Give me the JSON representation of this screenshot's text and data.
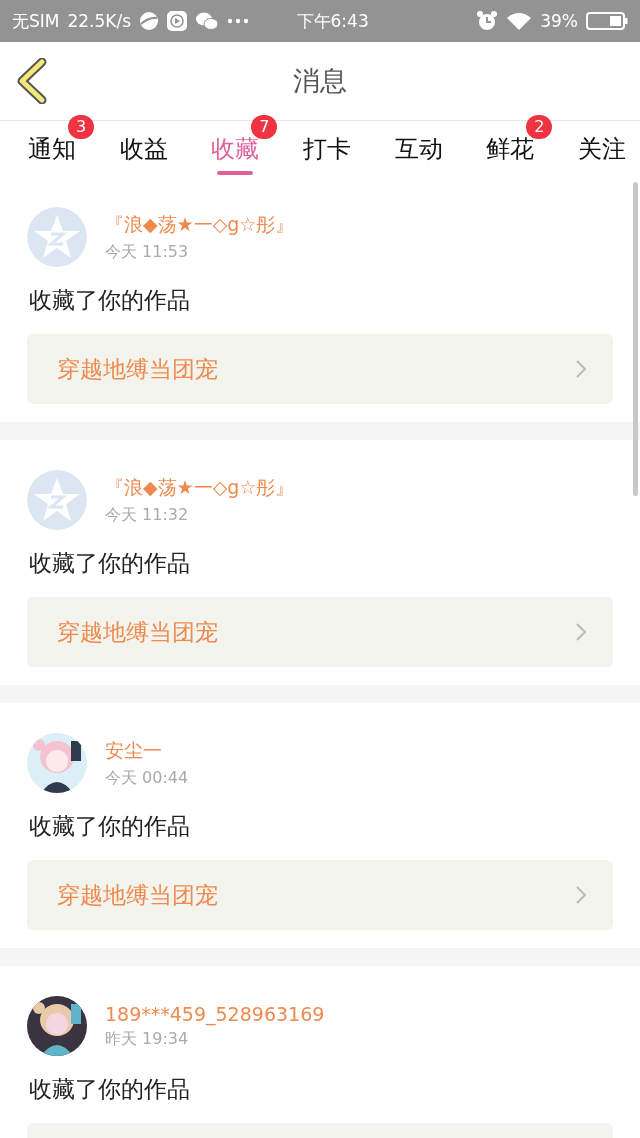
{
  "status_bar": {
    "carrier": "无SIM",
    "speed": "22.5K/s",
    "time": "下午6:43",
    "battery": "39%"
  },
  "header": {
    "title": "消息"
  },
  "tabs": [
    {
      "label": "通知",
      "selected": false,
      "badge": "3"
    },
    {
      "label": "收益",
      "selected": false
    },
    {
      "label": "收藏",
      "selected": true,
      "badge": "7"
    },
    {
      "label": "打卡",
      "selected": false
    },
    {
      "label": "互动",
      "selected": false
    },
    {
      "label": "鲜花",
      "selected": false,
      "badge": "2"
    },
    {
      "label": "关注",
      "selected": false
    }
  ],
  "messages": [
    {
      "avatar": {
        "kind": "default"
      },
      "name": "『浪◆荡★一◇g☆彤』",
      "time": "今天 11:53",
      "text": "收藏了你的作品",
      "work": "穿越地缚当团宠"
    },
    {
      "avatar": {
        "kind": "default"
      },
      "name": "『浪◆荡★一◇g☆彤』",
      "time": "今天 11:32",
      "text": "收藏了你的作品",
      "work": "穿越地缚当团宠"
    },
    {
      "name": "安尘一",
      "time": "今天 00:44",
      "text": "收藏了你的作品",
      "work": "穿越地缚当团宠"
    },
    {
      "name": "189***459_528963169",
      "time": "昨天 19:34",
      "text": "收藏了你的作品"
    }
  ]
}
